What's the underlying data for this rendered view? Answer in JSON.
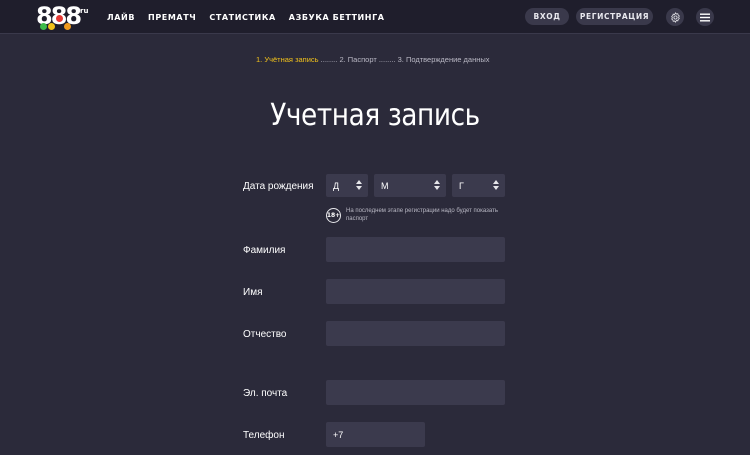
{
  "header": {
    "logo_text": "888",
    "logo_suffix": "ru",
    "nav": [
      "ЛАЙВ",
      "ПРЕМАТЧ",
      "СТАТИСТИКА",
      "АЗБУКА БЕТТИНГА"
    ],
    "login_label": "ВХОД",
    "register_label": "РЕГИСТРАЦИЯ",
    "settings_icon": "gear-icon",
    "menu_icon": "hamburger-icon"
  },
  "steps": {
    "step1": "1. Учётная запись",
    "sep1": " ........ ",
    "step2": "2. Паспорт",
    "sep2": " ........ ",
    "step3": "3. Подтверждение данных"
  },
  "title": "Учетная запись",
  "form": {
    "birth_label": "Дата рождения",
    "day_value": "Д",
    "month_value": "М",
    "year_value": "Г",
    "age_badge": "18+",
    "age_note": "На последнем этапе регистрации надо будет показать паспорт",
    "surname_label": "Фамилия",
    "name_label": "Имя",
    "patronymic_label": "Отчество",
    "email_label": "Эл. почта",
    "phone_label": "Телефон",
    "phone_value": "+7"
  },
  "colors": {
    "background": "#2b2a3a",
    "header": "#1f1e2c",
    "input": "#3b3a4d",
    "accent": "#f2c21b"
  }
}
